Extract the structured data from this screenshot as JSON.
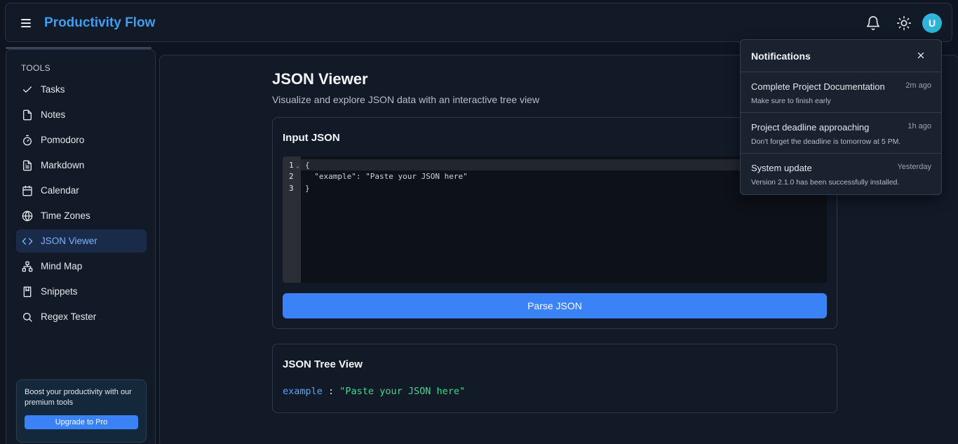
{
  "app": {
    "title": "Productivity Flow",
    "avatar_initial": "U"
  },
  "sidebar": {
    "section_label": "TOOLS",
    "items": [
      {
        "label": "Tasks",
        "icon": "check-icon"
      },
      {
        "label": "Notes",
        "icon": "file-icon"
      },
      {
        "label": "Pomodoro",
        "icon": "timer-icon"
      },
      {
        "label": "Markdown",
        "icon": "file-text-icon"
      },
      {
        "label": "Calendar",
        "icon": "calendar-icon"
      },
      {
        "label": "Time Zones",
        "icon": "globe-icon"
      },
      {
        "label": "JSON Viewer",
        "icon": "code-icon",
        "active": true
      },
      {
        "label": "Mind Map",
        "icon": "network-icon"
      },
      {
        "label": "Snippets",
        "icon": "book-icon"
      },
      {
        "label": "Regex Tester",
        "icon": "search-icon"
      }
    ],
    "promo": {
      "text": "Boost your productivity with our premium tools",
      "button": "Upgrade to Pro"
    }
  },
  "main": {
    "title": "JSON Viewer",
    "subtitle": "Visualize and explore JSON data with an interactive tree view",
    "input_card": {
      "title": "Input JSON",
      "lines": [
        {
          "num": "1",
          "text": "{"
        },
        {
          "num": "2",
          "text": "  \"example\": \"Paste your JSON here\""
        },
        {
          "num": "3",
          "text": "}"
        }
      ],
      "button": "Parse JSON"
    },
    "tree_card": {
      "title": "JSON Tree View",
      "key": "example",
      "separator": " : ",
      "value": "\"Paste your JSON here\""
    }
  },
  "notifications": {
    "title": "Notifications",
    "items": [
      {
        "title": "Complete Project Documentation",
        "time": "2m ago",
        "desc": "Make sure to finish early"
      },
      {
        "title": "Project deadline approaching",
        "time": "1h ago",
        "desc": "Don't forget the deadline is tomorrow at 5 PM."
      },
      {
        "title": "System update",
        "time": "Yesterday",
        "desc": "Version 2.1.0 has been successfully installed."
      }
    ]
  },
  "colors": {
    "accent": "#3b82f6",
    "brand": "#3f9df2",
    "tree_key": "#5aa2f5",
    "tree_value": "#4ad48b"
  }
}
